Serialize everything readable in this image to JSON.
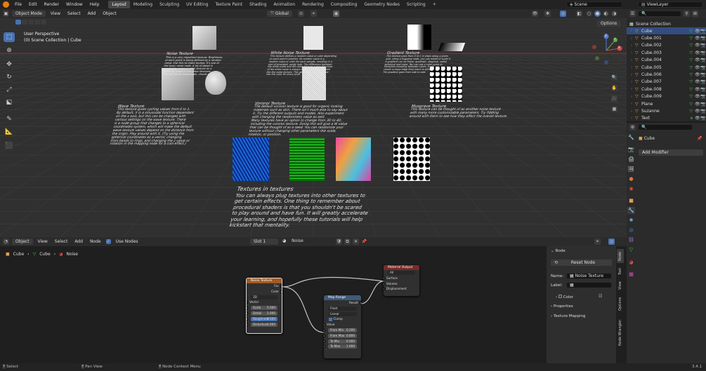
{
  "topbar": {
    "menus": [
      "File",
      "Edit",
      "Render",
      "Window",
      "Help"
    ],
    "workspaces": [
      "Layout",
      "Modeling",
      "Sculpting",
      "UV Editing",
      "Texture Paint",
      "Shading",
      "Animation",
      "Rendering",
      "Compositing",
      "Geometry Nodes",
      "Scripting"
    ],
    "active_workspace": "Layout",
    "add_tab": "+",
    "scene": "Scene",
    "view_layer": "ViewLayer"
  },
  "viewport": {
    "mode": "Object Mode",
    "menus": [
      "View",
      "Select",
      "Add",
      "Object"
    ],
    "transform": "Global",
    "options": "Options",
    "perspective": "User Perspective",
    "collection_info": "(0) Scene Collection | Cube",
    "text_blocks": [
      {
        "title": "Noise Texture",
        "body": "This is a very important texture. Brightness\nof each point is being defined by a random\nnoise. Use this to make bumps. It's one of\nthe basic noise node. A lot of detail is\ncreated by using a noise texture as a\nfactor for some of the other textures.\nThis can be for landscapes, clouds or bumps."
      },
      {
        "title": "White Noise Texture",
        "body": "This texture defines a random value or color depending\non each point's position. Its random value is a\nrandom value or color for each sample, resulting in a\nsort of pixelated, sandy look. The difference between\nthe white noise and the noise texture is that the noise\nof the white noise is always random. It is not blurred\nlike the noise texture. This generates a single value\ninto the color for every pixel."
      },
      {
        "title": "Gradient Texture",
        "body": "This texture goes from 0 to 1 in steps along a given\naxis. Using a mapping node, you can rotate or scale it.\nA gradient can be linear, quadratic, diagonal, radial,\nspherical and more. You can use a color ramp to\ntransition smoothly between colors. It will\ncreate a sharp edge from black to white.\nThe gradient goes from side to side."
      },
      {
        "title": "Wave Texture",
        "body": "This texture gives cycling values from 0 to 1.\nBy default, it is a sinusoidal function dependant\non the x axis, but this can be changed with\nvarious settings on the wave texture. There\nis a node group that changes to a spherical\ncoordinates system, which will make the default\nwave texture values depend on the distance from\nthe origin. Play around with it. (Try using the\nspherical coordinates as a vector, changing\nfrom bands to rings, and changing the z value or\nrotation in the mapping node for a cool effect.)"
      },
      {
        "title": "Voronoi Texture",
        "body": "The default voronoi texture is good for organic looking\nmaterials such as skin. There isn't much else to say about\nit. Try the different outputs and modes. Also experiment\nwith changing the randomness value as well.\nMany textures have an option to change from 3D to 4D,\nincluding the voronoi texture. Doing this will give a W value\nthat can be thought of as a seed. You can randomize your\ntexture without changing other parameters like scale,\nrotation, or position."
      },
      {
        "title": "Musgrave Texture",
        "body": "This texture can be thought of as another noise texture\nwith many more customizable parameters. Try fiddling\naround with them to see how they affect the overall texture."
      },
      {
        "title": "Textures in textures",
        "body": "You can always plug textures into other textures to\nget certain effects. One thing to remember about\nprocedural shaders is that you shouldn't be scared\nto play around and have fun. It will greatly accelerate\nyour learning, and hopefully these tutorials will help\nkickstart that mentality."
      }
    ],
    "gizmo": {
      "x": "X",
      "y": "Y",
      "z": "Z"
    }
  },
  "outliner": {
    "root": "Scene Collection",
    "items": [
      "Cube",
      "Cube.001",
      "Cube.002",
      "Cube.003",
      "Cube.004",
      "Cube.005",
      "Cube.006",
      "Cube.007",
      "Cube.008",
      "Cube.009",
      "Plane",
      "Suzanne",
      "Text"
    ]
  },
  "properties": {
    "object_name": "Cube",
    "add_modifier": "Add Modifier"
  },
  "node_editor": {
    "type": "Object",
    "menus": [
      "View",
      "Select",
      "Add",
      "Node"
    ],
    "use_nodes_label": "Use Nodes",
    "slot": "Slot 1",
    "material": "Noise",
    "breadcrumb": [
      "Cube",
      "Cube",
      "Noise"
    ],
    "nodes": {
      "noise": {
        "title": "Noise Texture",
        "outputs": [
          "Fac",
          "Color"
        ],
        "dimension": "3D",
        "vector": "Vector",
        "fields": [
          {
            "label": "Scale",
            "value": "5.000"
          },
          {
            "label": "Detail",
            "value": "2.000"
          },
          {
            "label": "Roughness",
            "value": "0.500"
          },
          {
            "label": "Distortion",
            "value": "0.000"
          }
        ]
      },
      "map_range": {
        "title": "Map Range",
        "output": "Result",
        "type": "Float",
        "interp": "Linear",
        "clamp": "Clamp",
        "value": "Value",
        "fields": [
          {
            "label": "From Min",
            "value": "0.200"
          },
          {
            "label": "From Max",
            "value": "0.800"
          },
          {
            "label": "To Min",
            "value": "0.000"
          },
          {
            "label": "To Max",
            "value": "1.000"
          }
        ]
      },
      "output": {
        "title": "Material Output",
        "target": "All",
        "inputs": [
          "Surface",
          "Volume",
          "Displacement"
        ]
      }
    }
  },
  "npanel": {
    "section": "Node",
    "reset": "Reset Node",
    "name_label": "Name:",
    "name_value": "Noise Texture",
    "label_label": "Label:",
    "label_value": "",
    "color": "Color",
    "properties": "Properties",
    "texture_mapping": "Texture Mapping",
    "tabs": [
      "Node",
      "Tool",
      "View",
      "Options",
      "Node Wrangler"
    ]
  },
  "statusbar": {
    "select": "Select",
    "pan": "Pan View",
    "context": "Node Context Menu",
    "version": "3.4.1"
  },
  "colors": {
    "accent": "#4772b3",
    "node_noise_header": "#a45a22",
    "node_map_header": "#3e5a7a",
    "node_output_header": "#7a2a2a"
  }
}
